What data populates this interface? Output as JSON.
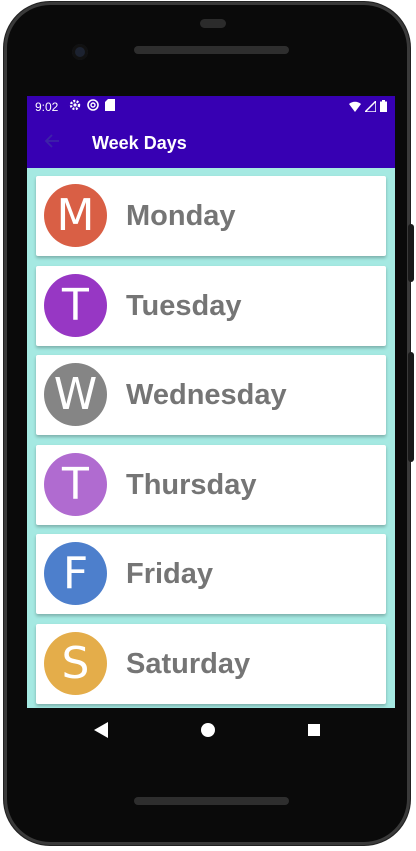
{
  "status_bar": {
    "time": "9:02",
    "icons_left": [
      "gear-icon",
      "at-icon",
      "sd-card-icon"
    ],
    "icons_right": [
      "wifi-icon",
      "signal-icon",
      "battery-icon"
    ]
  },
  "app_bar": {
    "back_icon": "arrow-left-icon",
    "title": "Week Days"
  },
  "days": [
    {
      "letter": "M",
      "label": "Monday",
      "color": "#d95f45"
    },
    {
      "letter": "T",
      "label": "Tuesday",
      "color": "#9737c4"
    },
    {
      "letter": "W",
      "label": "Wednesday",
      "color": "#858585"
    },
    {
      "letter": "T",
      "label": "Thursday",
      "color": "#b06bd0"
    },
    {
      "letter": "F",
      "label": "Friday",
      "color": "#4d7fcc"
    },
    {
      "letter": "S",
      "label": "Saturday",
      "color": "#e4ad4a"
    }
  ],
  "nav_bar": {
    "back_icon": "nav-back-icon",
    "home_icon": "nav-home-icon",
    "recents_icon": "nav-recents-icon"
  },
  "colors": {
    "primary": "#3700b3",
    "list_background": "#a5e9e2",
    "label_text": "#757575"
  }
}
